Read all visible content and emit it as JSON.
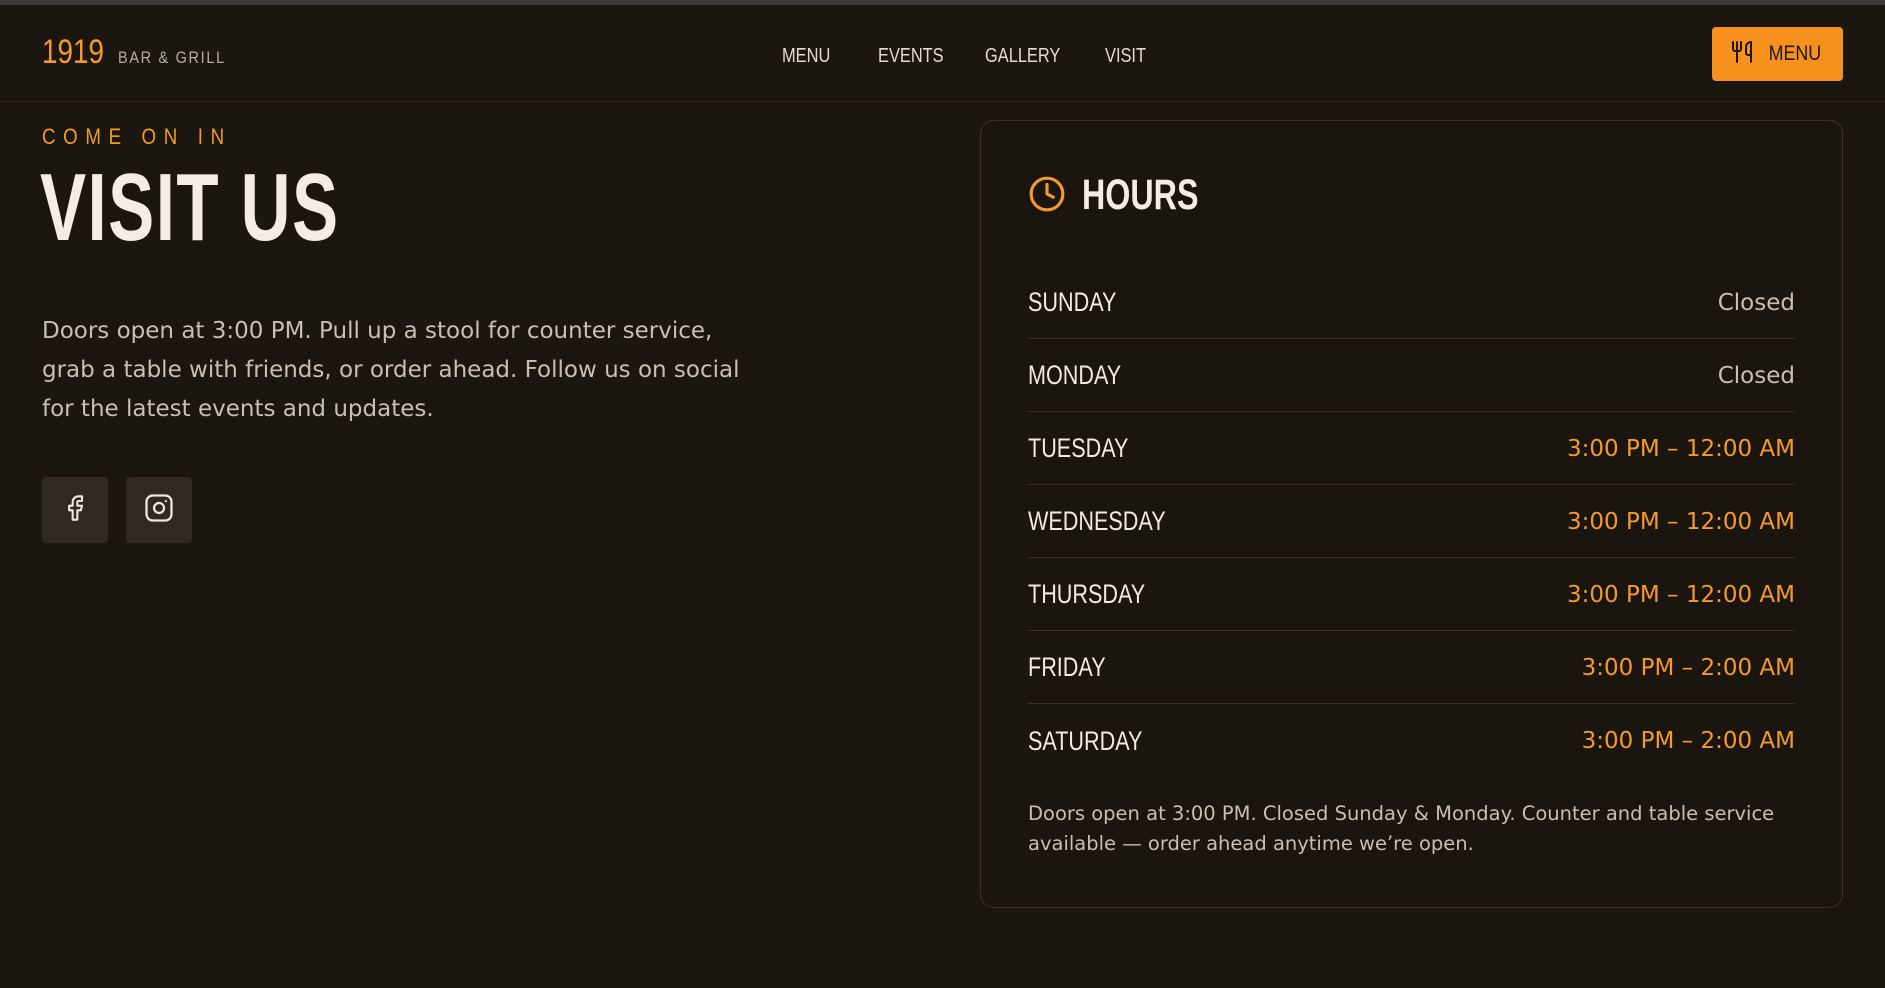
{
  "brand": {
    "number": "1919",
    "subtitle": "BAR & GRILL"
  },
  "nav": {
    "items": [
      "MENU",
      "EVENTS",
      "GALLERY",
      "VISIT"
    ]
  },
  "header_button": {
    "label": "MENU",
    "icon": "utensils-icon"
  },
  "hero": {
    "eyebrow": "COME ON IN",
    "title": "VISIT US",
    "intro": "Doors open at 3:00 PM. Pull up a stool for counter service, grab a table with friends, or order ahead. Follow us on social for the latest events and updates."
  },
  "social": [
    {
      "name": "facebook",
      "icon": "facebook-icon"
    },
    {
      "name": "instagram",
      "icon": "instagram-icon"
    }
  ],
  "hours": {
    "title": "HOURS",
    "icon": "clock-icon",
    "rows": [
      {
        "day": "SUNDAY",
        "time": "Closed",
        "status": "closed"
      },
      {
        "day": "MONDAY",
        "time": "Closed",
        "status": "closed"
      },
      {
        "day": "TUESDAY",
        "time": "3:00 PM – 12:00 AM",
        "status": "open"
      },
      {
        "day": "WEDNESDAY",
        "time": "3:00 PM – 12:00 AM",
        "status": "open"
      },
      {
        "day": "THURSDAY",
        "time": "3:00 PM – 12:00 AM",
        "status": "open"
      },
      {
        "day": "FRIDAY",
        "time": "3:00 PM – 2:00 AM",
        "status": "open"
      },
      {
        "day": "SATURDAY",
        "time": "3:00 PM – 2:00 AM",
        "status": "open"
      }
    ],
    "note": "Doors open at 3:00 PM. Closed Sunday & Monday. Counter and table service available — order ahead anytime we’re open."
  },
  "colors": {
    "background": "#1c1611",
    "accent": "#f6911e",
    "text": "#efe8df",
    "muted": "#c9bfb3"
  }
}
